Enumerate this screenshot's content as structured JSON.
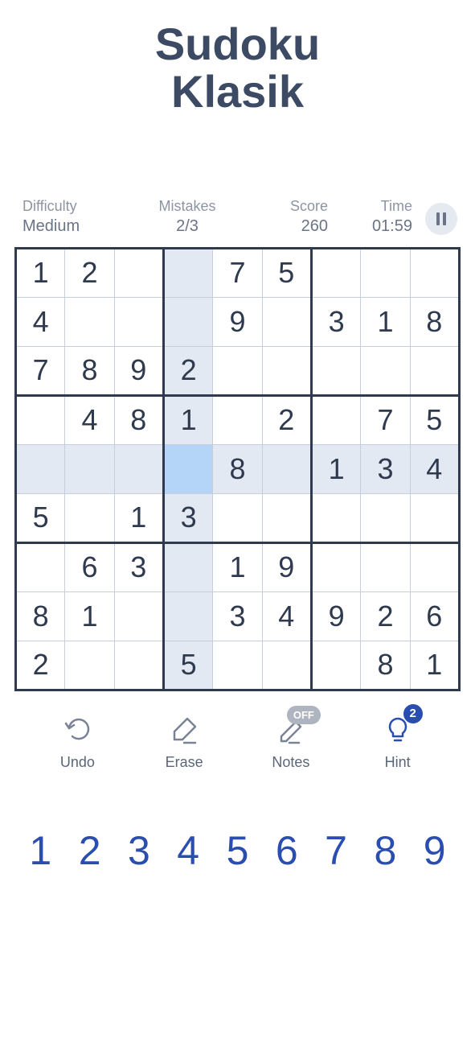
{
  "title_line1": "Sudoku",
  "title_line2": "Klasik",
  "stats": {
    "difficulty_label": "Difficulty",
    "difficulty_value": "Medium",
    "mistakes_label": "Mistakes",
    "mistakes_value": "2/3",
    "score_label": "Score",
    "score_value": "260",
    "time_label": "Time",
    "time_value": "01:59"
  },
  "pause_icon": "pause",
  "board": [
    [
      "1",
      "2",
      "",
      "",
      "7",
      "5",
      "",
      "",
      ""
    ],
    [
      "4",
      "",
      "",
      "",
      "9",
      "",
      "3",
      "1",
      "8"
    ],
    [
      "7",
      "8",
      "9",
      "2",
      "",
      "",
      "",
      "",
      ""
    ],
    [
      "",
      "4",
      "8",
      "1",
      "",
      "2",
      "",
      "7",
      "5"
    ],
    [
      "",
      "",
      "",
      "",
      "8",
      "",
      "1",
      "3",
      "4"
    ],
    [
      "5",
      "",
      "1",
      "3",
      "",
      "",
      "",
      "",
      ""
    ],
    [
      "",
      "6",
      "3",
      "",
      "1",
      "9",
      "",
      "",
      ""
    ],
    [
      "8",
      "1",
      "",
      "",
      "3",
      "4",
      "9",
      "2",
      "6"
    ],
    [
      "2",
      "",
      "",
      "5",
      "",
      "",
      "",
      "8",
      "1"
    ]
  ],
  "highlight_row": 4,
  "highlight_col": 3,
  "selected": {
    "row": 4,
    "col": 3
  },
  "tools": {
    "undo": "Undo",
    "erase": "Erase",
    "notes": "Notes",
    "notes_badge": "OFF",
    "hint": "Hint",
    "hint_count": "2"
  },
  "numpad": [
    "1",
    "2",
    "3",
    "4",
    "5",
    "6",
    "7",
    "8",
    "9"
  ]
}
